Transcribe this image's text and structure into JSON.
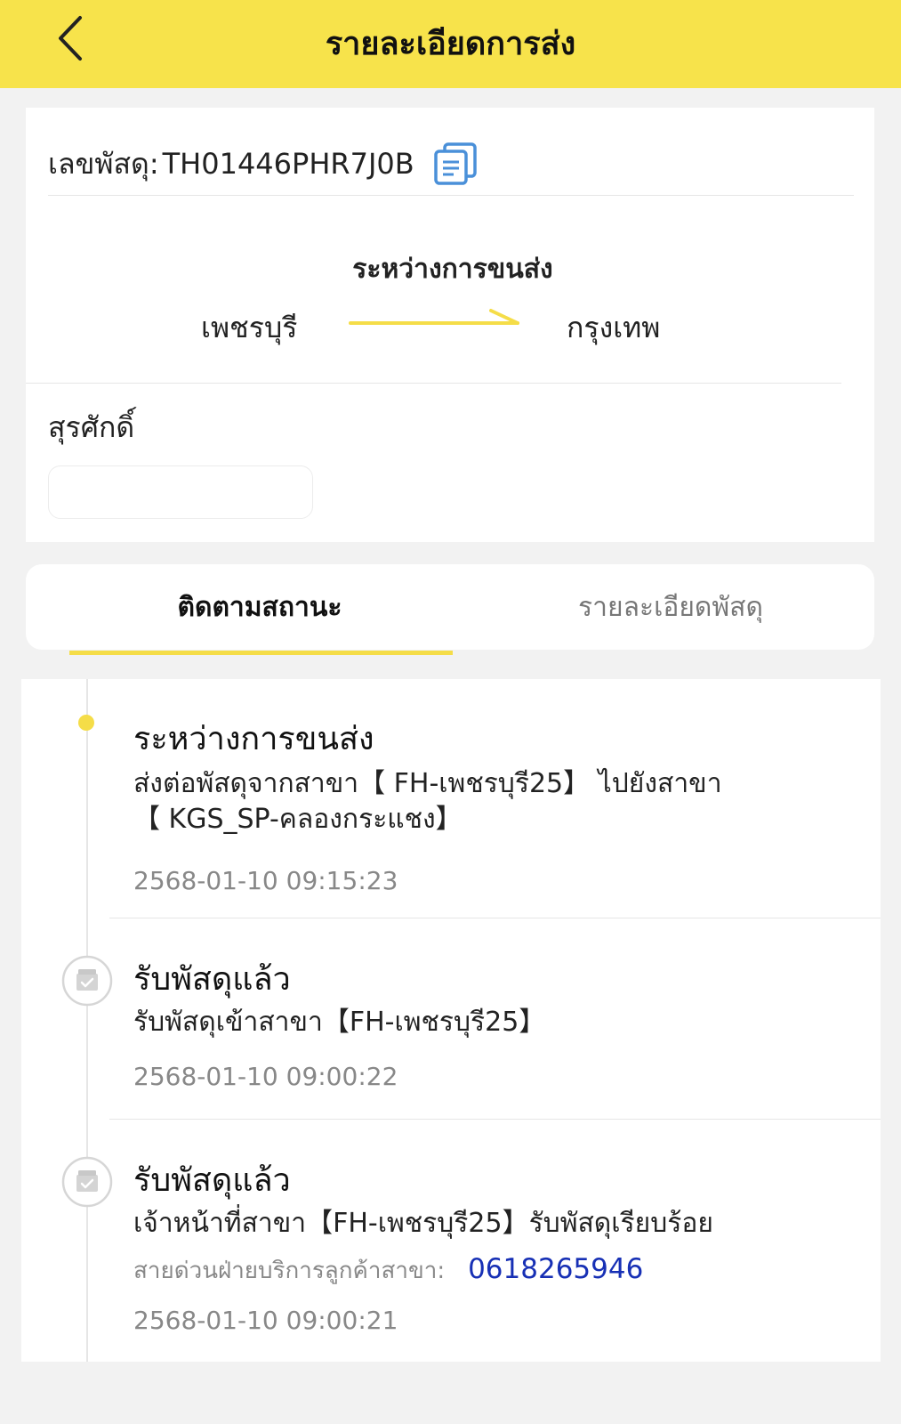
{
  "header": {
    "title": "รายละเอียดการส่ง",
    "back_icon": "chevron-left-icon"
  },
  "parcel": {
    "tracking_label": "เลขพัสดุ:",
    "tracking_number": "TH01446PHR7J0B",
    "copy_icon": "copy-icon",
    "status": "ระหว่างการขนส่ง",
    "origin": "เพชรบุรี",
    "destination": "กรุงเทพ",
    "route_color": "#f5dd48",
    "receiver_name": "สุรศักดิ์"
  },
  "tabs": {
    "status_label": "ติดตามสถานะ",
    "detail_label": "รายละเอียดพัสดุ",
    "active": "status",
    "accent": "#f5dd48"
  },
  "timeline": {
    "events": [
      {
        "title": "ระหว่างการขนส่ง",
        "description_line1": "ส่งต่อพัสดุจากสาขา【 FH-เพชรบุรี25】 ไปยังสาขา",
        "description_line2": "【 KGS_SP-คลองกระแชง】",
        "time": "2568-01-10 09:15:23",
        "icon": "active-dot"
      },
      {
        "title": "รับพัสดุแล้ว",
        "description_line1": "รับพัสดุเข้าสาขา【FH-เพชรบุรี25】",
        "time": "2568-01-10 09:00:22",
        "icon": "parcel-box-icon"
      },
      {
        "title": "รับพัสดุแล้ว",
        "description_line1": "เจ้าหน้าที่สาขา【FH-เพชรบุรี25】รับพัสดุเรียบร้อย",
        "hotline_label": "สายด่วนฝ่ายบริการลูกค้าสาขา:",
        "hotline_phone": "0618265946",
        "time": "2568-01-10 09:00:21",
        "icon": "parcel-box-icon"
      }
    ]
  }
}
